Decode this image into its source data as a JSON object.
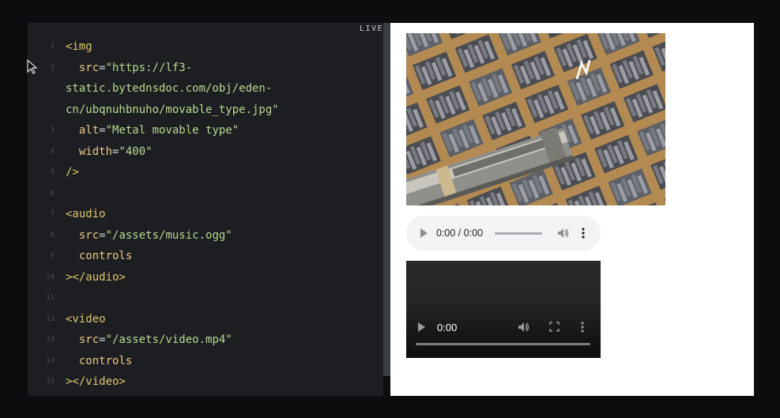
{
  "preview": {
    "live_label": "LIVE",
    "image_alt": "Metal movable type",
    "audio": {
      "time": "0:00 / 0:00"
    },
    "video": {
      "time": "0:00"
    }
  },
  "code": [
    {
      "n": "1",
      "tokens": [
        {
          "t": "tag",
          "v": "<img"
        }
      ]
    },
    {
      "n": "2",
      "tokens": [
        {
          "t": "plain",
          "v": "  "
        },
        {
          "t": "attr",
          "v": "src"
        },
        {
          "t": "plain",
          "v": "="
        },
        {
          "t": "str",
          "v": "\"https://lf3-"
        }
      ]
    },
    {
      "n": "",
      "tokens": [
        {
          "t": "str",
          "v": "static.bytednsdoc.com/obj/eden-"
        }
      ]
    },
    {
      "n": "",
      "tokens": [
        {
          "t": "str",
          "v": "cn/ubqnuhbnuho/movable_type.jpg\""
        }
      ]
    },
    {
      "n": "3",
      "tokens": [
        {
          "t": "plain",
          "v": "  "
        },
        {
          "t": "attr",
          "v": "alt"
        },
        {
          "t": "plain",
          "v": "="
        },
        {
          "t": "str",
          "v": "\"Metal movable type\""
        }
      ]
    },
    {
      "n": "4",
      "tokens": [
        {
          "t": "plain",
          "v": "  "
        },
        {
          "t": "attr",
          "v": "width"
        },
        {
          "t": "plain",
          "v": "="
        },
        {
          "t": "str",
          "v": "\"400\""
        }
      ]
    },
    {
      "n": "5",
      "tokens": [
        {
          "t": "tag",
          "v": "/>"
        }
      ]
    },
    {
      "n": "6",
      "tokens": []
    },
    {
      "n": "7",
      "tokens": [
        {
          "t": "tag",
          "v": "<audio"
        }
      ]
    },
    {
      "n": "8",
      "tokens": [
        {
          "t": "plain",
          "v": "  "
        },
        {
          "t": "attr",
          "v": "src"
        },
        {
          "t": "plain",
          "v": "="
        },
        {
          "t": "str",
          "v": "\"/assets/music.ogg\""
        }
      ]
    },
    {
      "n": "9",
      "tokens": [
        {
          "t": "plain",
          "v": "  "
        },
        {
          "t": "attr",
          "v": "controls"
        }
      ]
    },
    {
      "n": "10",
      "tokens": [
        {
          "t": "tag",
          "v": "></audio>"
        }
      ]
    },
    {
      "n": "11",
      "tokens": []
    },
    {
      "n": "12",
      "tokens": [
        {
          "t": "tag",
          "v": "<video"
        }
      ]
    },
    {
      "n": "13",
      "tokens": [
        {
          "t": "plain",
          "v": "  "
        },
        {
          "t": "attr",
          "v": "src"
        },
        {
          "t": "plain",
          "v": "="
        },
        {
          "t": "str",
          "v": "\"/assets/video.mp4\""
        }
      ]
    },
    {
      "n": "14",
      "tokens": [
        {
          "t": "plain",
          "v": "  "
        },
        {
          "t": "attr",
          "v": "controls"
        }
      ]
    },
    {
      "n": "15",
      "tokens": [
        {
          "t": "tag",
          "v": "></video>"
        }
      ]
    }
  ]
}
